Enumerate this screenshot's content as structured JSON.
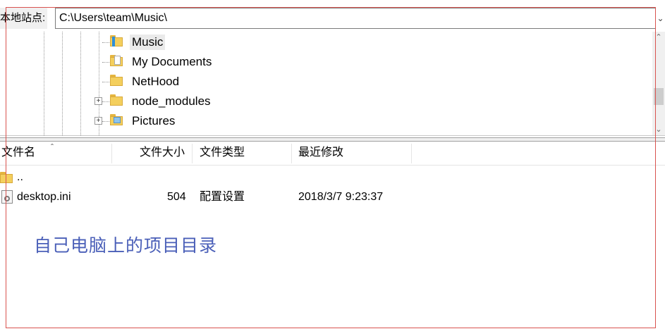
{
  "address_bar": {
    "label": "本地站点:",
    "path": "C:\\Users\\team\\Music\\"
  },
  "tree": {
    "items": [
      {
        "label": "Music",
        "selected": true,
        "icon": "music-folder-icon"
      },
      {
        "label": "My Documents",
        "selected": false,
        "icon": "document-folder-icon"
      },
      {
        "label": "NetHood",
        "selected": false,
        "icon": "folder-icon"
      },
      {
        "label": "node_modules",
        "selected": false,
        "icon": "folder-icon",
        "expandable": true
      },
      {
        "label": "Pictures",
        "selected": false,
        "icon": "pictures-folder-icon",
        "expandable": true
      }
    ]
  },
  "list": {
    "columns": [
      "文件名",
      "文件大小",
      "文件类型",
      "最近修改"
    ],
    "rows": [
      {
        "name": "..",
        "size": "",
        "type": "",
        "modified": "",
        "icon": "parent-folder-icon"
      },
      {
        "name": "desktop.ini",
        "size": "504",
        "type": "配置设置",
        "modified": "2018/3/7 9:23:37",
        "icon": "ini-file-icon"
      }
    ]
  },
  "annotation": {
    "caption": "自己电脑上的项目目录",
    "caption_color": "#4a5fb8",
    "box_color": "#d9534f"
  }
}
